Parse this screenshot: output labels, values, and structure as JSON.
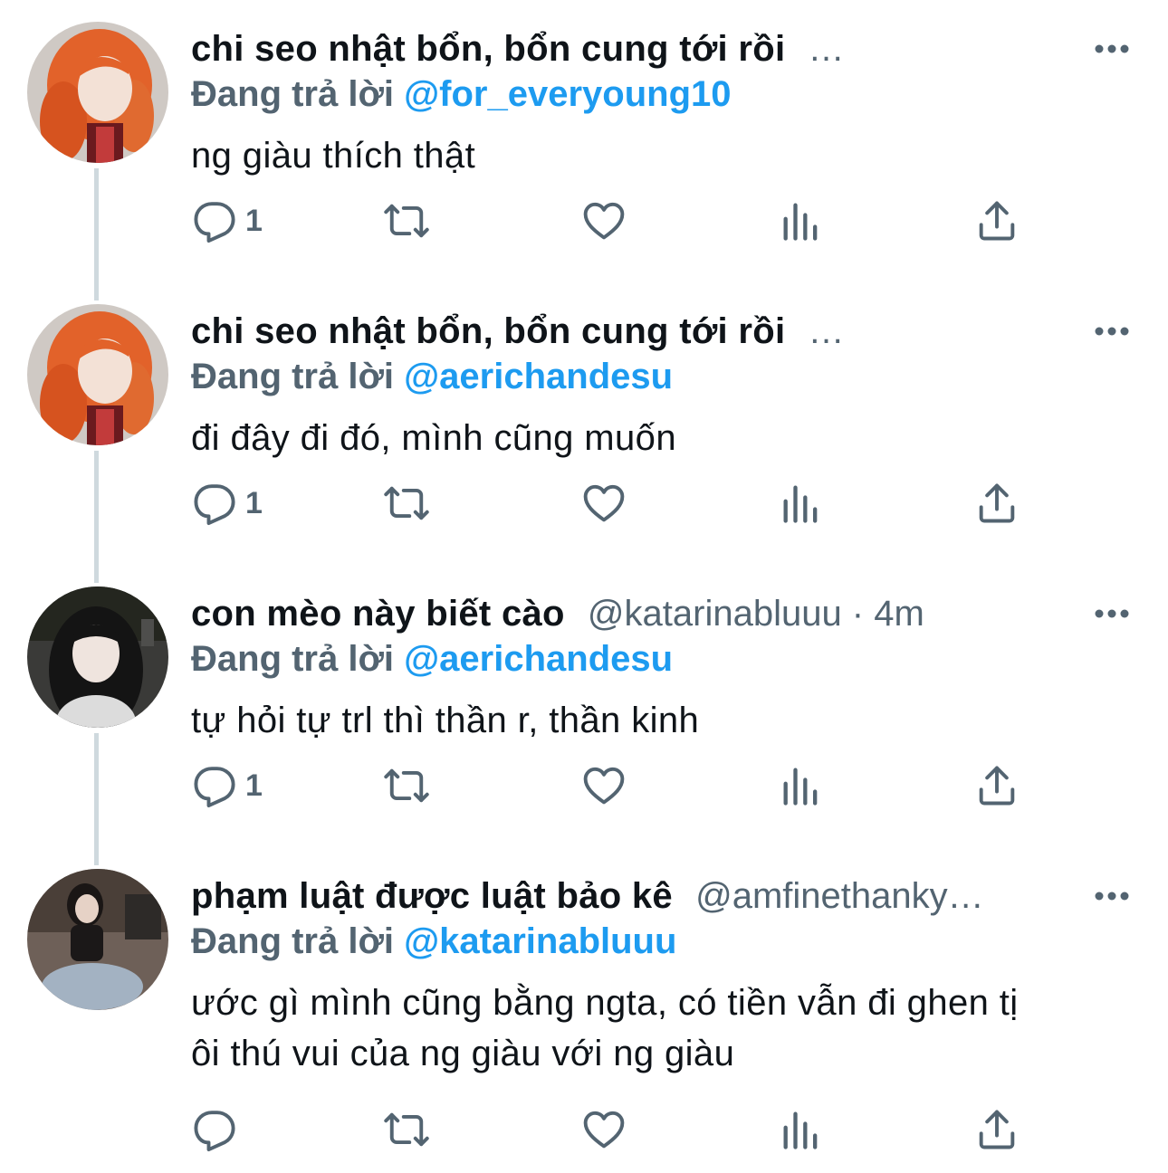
{
  "tweets": [
    {
      "author": "chi seo nhật bổn, bổn cung tới rồi",
      "handle": "…",
      "reply_prefix": "Đang trả lời",
      "reply_to": "@for_everyoung10",
      "text": "ng giàu thích thật",
      "reply_count": "1",
      "avatar": "orange-hair-avatar"
    },
    {
      "author": "chi seo nhật bổn, bổn cung tới rồi",
      "handle": "…",
      "reply_prefix": "Đang trả lời",
      "reply_to": "@aerichandesu",
      "text": "đi đây đi đó, mình cũng muốn",
      "reply_count": "1",
      "avatar": "orange-hair-avatar"
    },
    {
      "author": "con mèo này biết cào",
      "handle": "@katarinabluuu · 4m",
      "reply_prefix": "Đang trả lời",
      "reply_to": "@aerichandesu",
      "text": "tự hỏi tự trl thì thần r, thần kinh",
      "reply_count": "1",
      "avatar": "dark-hair-avatar"
    },
    {
      "author": "phạm luật được luật bảo kê",
      "handle": "@amfinethanky…",
      "reply_prefix": "Đang trả lời",
      "reply_to": "@katarinabluuu",
      "text": "ước gì mình cũng bằng ngta, có tiền vẫn đi ghen tị\nôi thú vui của ng giàu với ng giàu",
      "reply_count": "",
      "avatar": "seated-person-avatar"
    }
  ],
  "icons": {
    "reply": "reply-icon",
    "retweet": "retweet-icon",
    "like": "heart-icon",
    "views": "views-icon",
    "share": "share-icon",
    "more": "more-icon"
  },
  "colors": {
    "text": "#0f1419",
    "secondary": "#536471",
    "accent": "#1d9bf0",
    "thread_line": "#cfd9de"
  }
}
